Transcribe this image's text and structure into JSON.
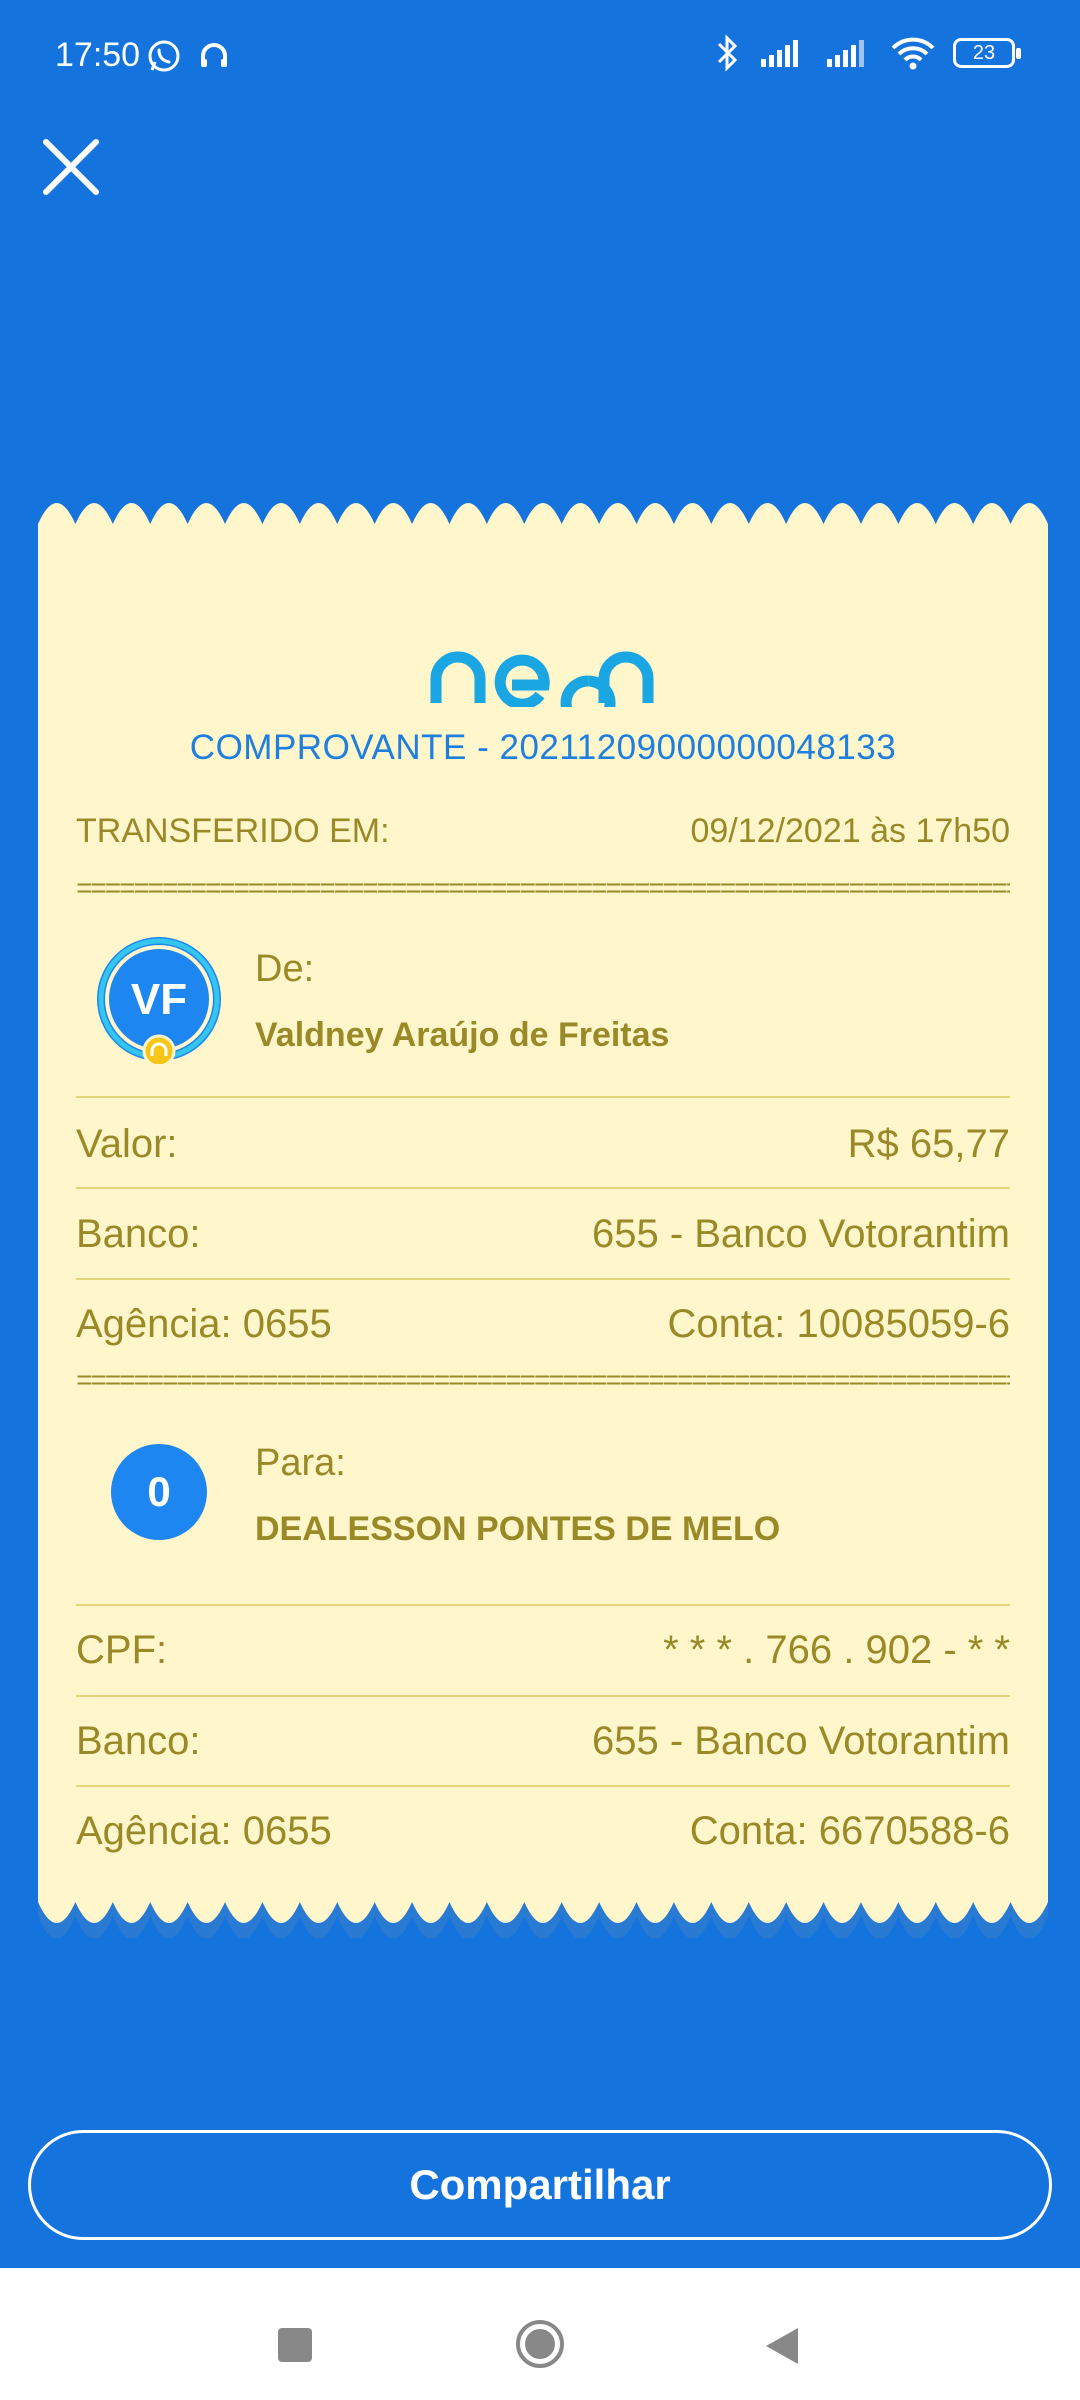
{
  "status_bar": {
    "time": "17:50",
    "battery": "23",
    "icons": [
      "whatsapp-icon",
      "headset-icon",
      "bluetooth-icon",
      "signal-icon",
      "signal-icon",
      "wifi-icon",
      "battery-icon"
    ]
  },
  "receipt": {
    "logo_text": "neon",
    "id_label": "COMPROVANTE - 20211209000000048133",
    "transfer": {
      "label": "TRANSFERIDO EM:",
      "value": "09/12/2021 às 17h50"
    },
    "separator": "======================================================================",
    "from": {
      "avatar_initials": "VF",
      "label": "De:",
      "name": "Valdney Araújo de Freitas",
      "value_label": "Valor:",
      "value": "R$ 65,77",
      "bank_label": "Banco:",
      "bank": "655 - Banco Votorantim",
      "agency": "Agência: 0655",
      "account": "Conta: 10085059-6"
    },
    "to": {
      "avatar_initials": "0",
      "label": "Para:",
      "name": "DEALESSON PONTES DE MELO",
      "cpf_label": "CPF:",
      "cpf": "* * * . 766 . 902 - * *",
      "bank_label": "Banco:",
      "bank": "655 - Banco Votorantim",
      "agency": "Agência: 0655",
      "account": "Conta: 6670588-6"
    }
  },
  "actions": {
    "share_label": "Compartilhar"
  },
  "colors": {
    "background": "#1573DD",
    "receipt": "#FFF6CC",
    "receipt_text": "#9A8A27",
    "accent": "#1E7FE0"
  }
}
